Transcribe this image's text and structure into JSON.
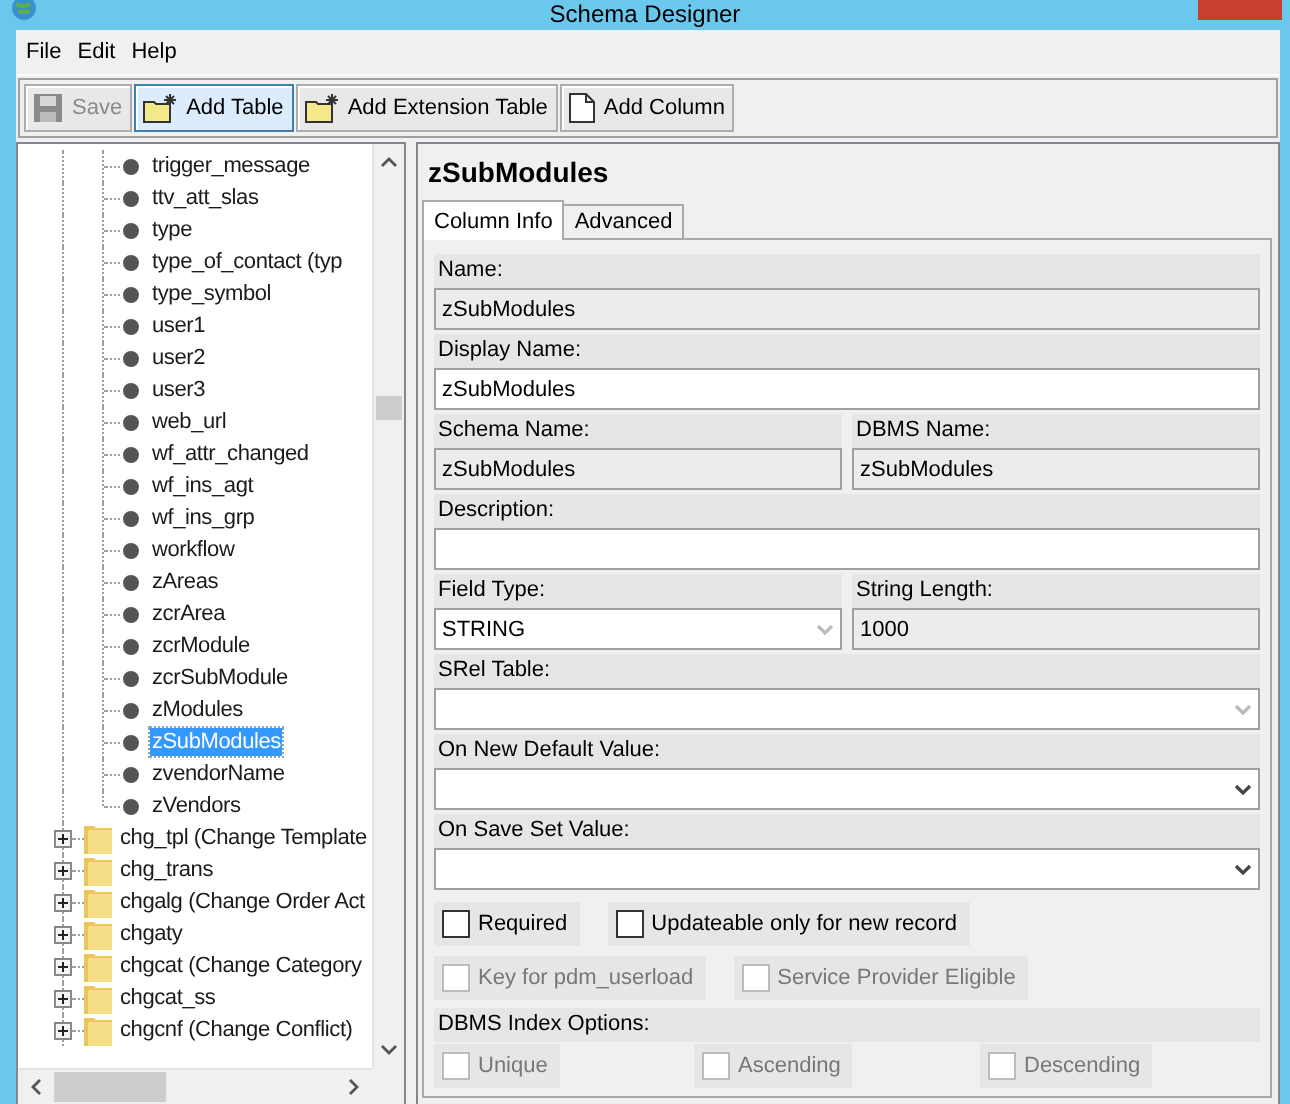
{
  "window": {
    "title": "Schema Designer"
  },
  "menu": [
    "File",
    "Edit",
    "Help"
  ],
  "toolbar": [
    {
      "label": "Save",
      "disabled": true,
      "selected": false
    },
    {
      "label": "Add Table",
      "disabled": false,
      "selected": true
    },
    {
      "label": "Add Extension Table",
      "disabled": false,
      "selected": false
    },
    {
      "label": "Add Column",
      "disabled": false,
      "selected": false
    }
  ],
  "tree": [
    {
      "label": "trigger_message",
      "kind": "leaf",
      "selected": false
    },
    {
      "label": "ttv_att_slas",
      "kind": "leaf",
      "selected": false
    },
    {
      "label": "type",
      "kind": "leaf",
      "selected": false
    },
    {
      "label": "type_of_contact (typ",
      "kind": "leaf",
      "selected": false
    },
    {
      "label": "type_symbol",
      "kind": "leaf",
      "selected": false
    },
    {
      "label": "user1",
      "kind": "leaf",
      "selected": false
    },
    {
      "label": "user2",
      "kind": "leaf",
      "selected": false
    },
    {
      "label": "user3",
      "kind": "leaf",
      "selected": false
    },
    {
      "label": "web_url",
      "kind": "leaf",
      "selected": false
    },
    {
      "label": "wf_attr_changed",
      "kind": "leaf",
      "selected": false
    },
    {
      "label": "wf_ins_agt",
      "kind": "leaf",
      "selected": false
    },
    {
      "label": "wf_ins_grp",
      "kind": "leaf",
      "selected": false
    },
    {
      "label": "workflow",
      "kind": "leaf",
      "selected": false
    },
    {
      "label": "zAreas",
      "kind": "leaf",
      "selected": false
    },
    {
      "label": "zcrArea",
      "kind": "leaf",
      "selected": false
    },
    {
      "label": "zcrModule",
      "kind": "leaf",
      "selected": false
    },
    {
      "label": "zcrSubModule",
      "kind": "leaf",
      "selected": false
    },
    {
      "label": "zModules",
      "kind": "leaf",
      "selected": false
    },
    {
      "label": "zSubModules",
      "kind": "leaf",
      "selected": true
    },
    {
      "label": "zvendorName",
      "kind": "leaf",
      "selected": false
    },
    {
      "label": "zVendors",
      "kind": "leaf",
      "selected": false
    },
    {
      "label": "chg_tpl (Change Template",
      "kind": "folder",
      "selected": false
    },
    {
      "label": "chg_trans",
      "kind": "folder",
      "selected": false
    },
    {
      "label": "chgalg (Change Order Act",
      "kind": "folder",
      "selected": false
    },
    {
      "label": "chgaty",
      "kind": "folder",
      "selected": false
    },
    {
      "label": "chgcat (Change Category",
      "kind": "folder",
      "selected": false
    },
    {
      "label": "chgcat_ss",
      "kind": "folder",
      "selected": false
    },
    {
      "label": "chgcnf (Change Conflict)",
      "kind": "folder",
      "selected": false
    }
  ],
  "detail": {
    "title": "zSubModules",
    "tabs": [
      {
        "label": "Column Info",
        "selected": true
      },
      {
        "label": "Advanced",
        "selected": false
      }
    ],
    "rows": [
      [
        {
          "label": "Name:",
          "value": "zSubModules",
          "kind": "text",
          "readonly": true
        }
      ],
      [
        {
          "label": "Display Name:",
          "value": "zSubModules",
          "kind": "text",
          "readonly": false
        }
      ],
      [
        {
          "label": "Schema Name:",
          "value": "zSubModules",
          "kind": "text",
          "readonly": true
        },
        {
          "label": "DBMS Name:",
          "value": "zSubModules",
          "kind": "text",
          "readonly": true
        }
      ],
      [
        {
          "label": "Description:",
          "kind": "text",
          "readonly": false
        }
      ],
      [
        {
          "label": "Field Type:",
          "value": "STRING",
          "kind": "select",
          "readonly": true
        },
        {
          "label": "String Length:",
          "value": "1000",
          "kind": "text",
          "readonly": true
        }
      ],
      [
        {
          "label": "SRel Table:",
          "kind": "select",
          "readonly": true
        }
      ],
      [
        {
          "label": "On New Default Value:",
          "kind": "select",
          "readonly": false
        }
      ],
      [
        {
          "label": "On Save Set Value:",
          "kind": "select",
          "readonly": false
        }
      ]
    ],
    "options": [
      {
        "label": "Required",
        "checked": false,
        "disabled": false
      },
      {
        "label": "Updateable only for new record",
        "checked": false,
        "disabled": false
      },
      {
        "label": "Key for pdm_userload",
        "checked": false,
        "disabled": true
      },
      {
        "label": "Service Provider Eligible",
        "checked": false,
        "disabled": true
      }
    ],
    "index_label": "DBMS Index Options:",
    "index_options": [
      {
        "label": "Unique",
        "checked": false,
        "disabled": true
      },
      {
        "label": "Ascending",
        "checked": false,
        "disabled": true
      },
      {
        "label": "Descending",
        "checked": false,
        "disabled": true
      }
    ]
  }
}
